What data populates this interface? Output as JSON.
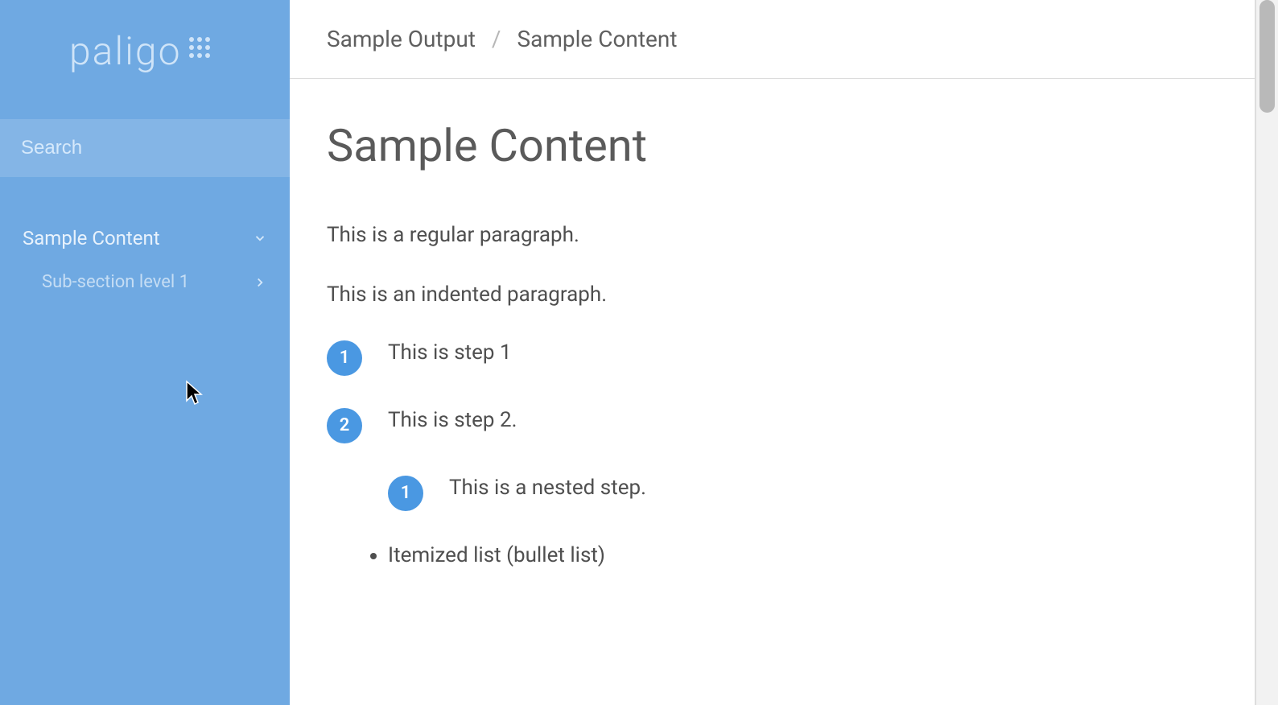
{
  "colors": {
    "sidebar_bg": "#6fa9e2",
    "accent": "#4a98e2"
  },
  "logo": {
    "text": "paligo"
  },
  "sidebar": {
    "search_placeholder": "Search",
    "items": [
      {
        "label": "Sample Content"
      },
      {
        "label": "Sub-section level 1"
      }
    ]
  },
  "breadcrumb": {
    "items": [
      {
        "label": "Sample Output"
      },
      {
        "label": "Sample Content"
      }
    ],
    "separator": "/"
  },
  "main": {
    "title": "Sample Content",
    "paragraphs": [
      "This is a regular paragraph.",
      "This is an indented paragraph."
    ],
    "steps": [
      {
        "num": "1",
        "text": "This is step 1"
      },
      {
        "num": "2",
        "text": "This is step 2."
      }
    ],
    "nested_steps": [
      {
        "num": "1",
        "text": "This is a nested step."
      }
    ],
    "bullets": [
      "Itemized list (bullet list)"
    ]
  }
}
